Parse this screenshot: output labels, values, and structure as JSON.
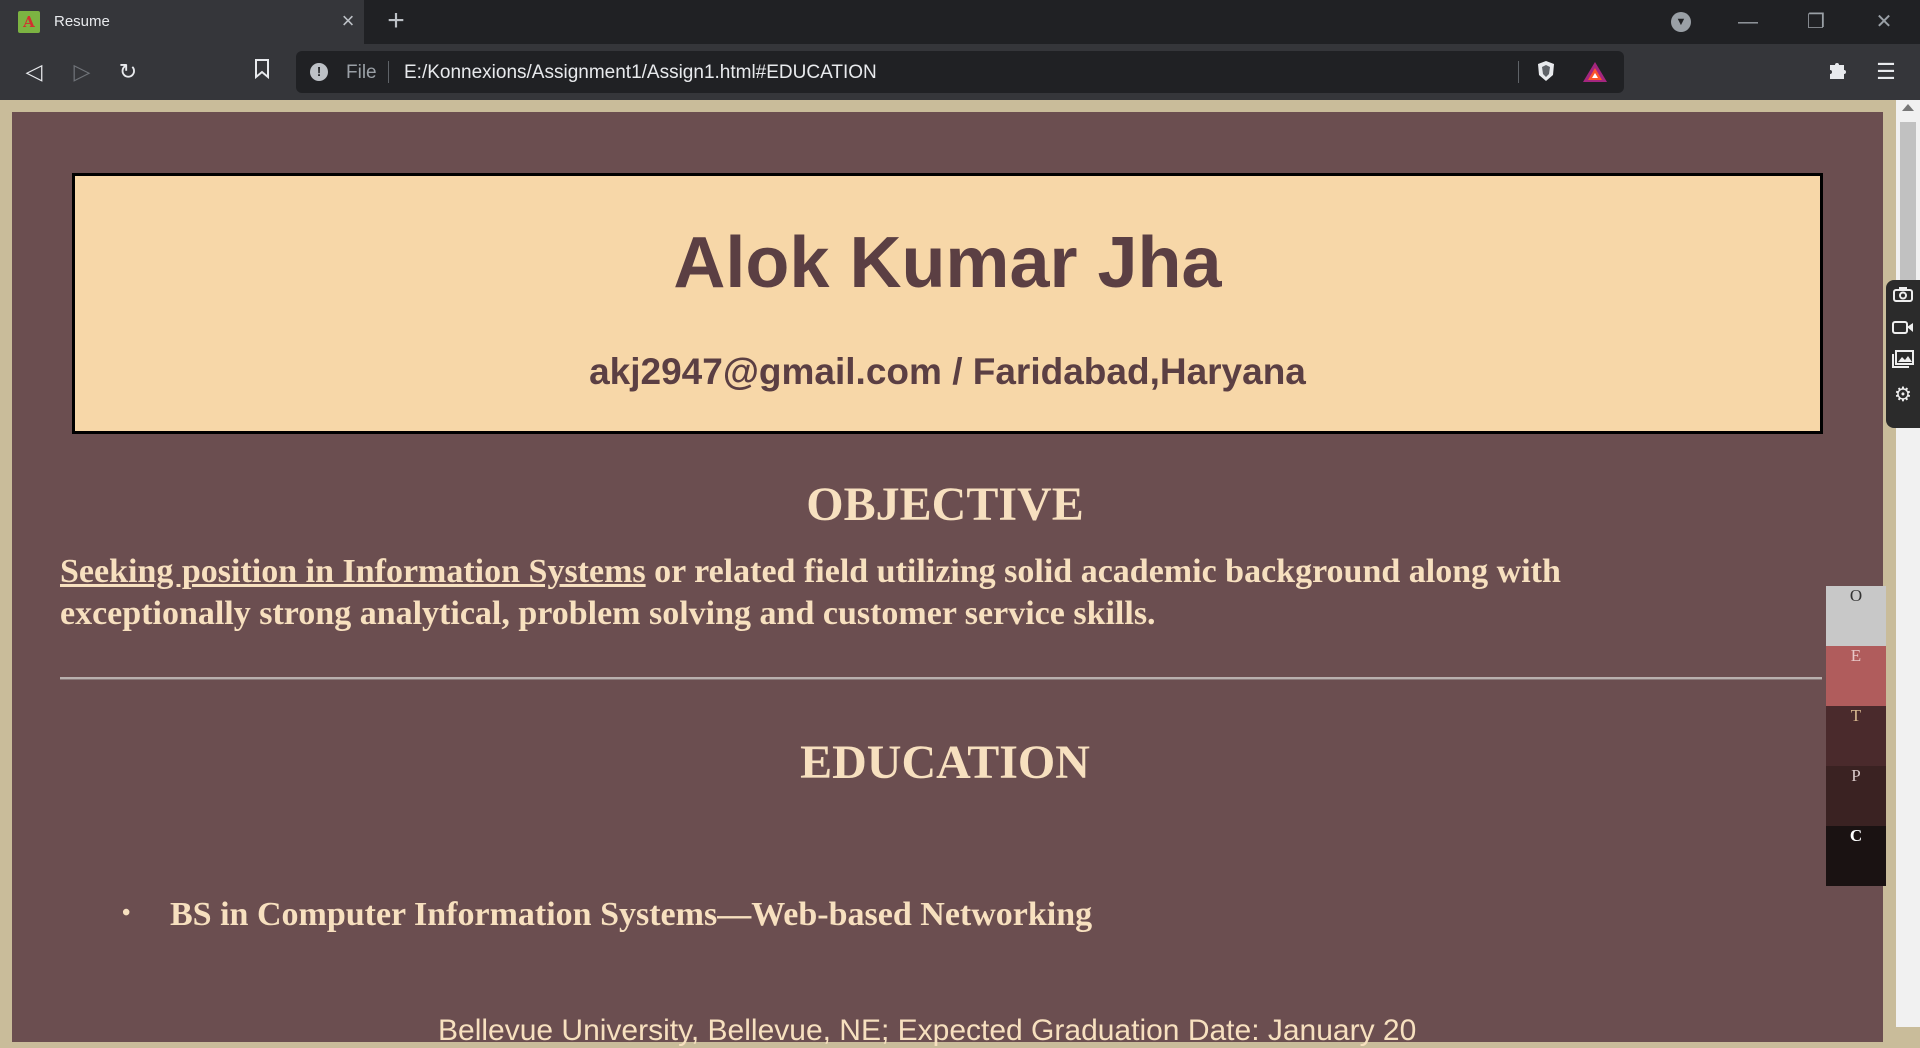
{
  "browser": {
    "tab_title": "Resume",
    "favicon_letter": "A",
    "url_scheme": "File",
    "url": "E:/Konnexions/Assignment1/Assign1.html#EDUCATION"
  },
  "header": {
    "name": "Alok Kumar Jha",
    "contact": "akj2947@gmail.com / Faridabad,Haryana"
  },
  "objective": {
    "title": "OBJECTIVE",
    "link_text": "Seeking position in Information Systems",
    "body_text": " or related field utilizing solid academic background along with exceptionally strong analytical, problem solving and customer service skills."
  },
  "education": {
    "title": "EDUCATION",
    "items": [
      {
        "degree": "BS in Computer Information Systems—Web-based Networking"
      }
    ],
    "detail_partial": "Bellevue University, Bellevue, NE; Expected Graduation Date: January 20"
  },
  "side_nav": [
    {
      "label": "O",
      "bg": "#c8c8c8",
      "fg": "#333333"
    },
    {
      "label": "E",
      "bg": "#b05c5c",
      "fg": "#e8c8c8"
    },
    {
      "label": "T",
      "bg": "#4a2a2c",
      "fg": "#d8b890"
    },
    {
      "label": "P",
      "bg": "#3a2222",
      "fg": "#d8c8c8"
    },
    {
      "label": "C",
      "bg": "#1a1212",
      "fg": "#ffffff"
    }
  ],
  "icons": {
    "back": "back-arrow-icon",
    "forward": "forward-arrow-icon",
    "reload": "reload-icon",
    "bookmark": "bookmark-icon",
    "extensions": "puzzle-icon",
    "menu": "hamburger-menu-icon",
    "camera": "camera-icon",
    "video": "video-icon",
    "gallery": "gallery-icon",
    "settings": "gear-icon"
  }
}
